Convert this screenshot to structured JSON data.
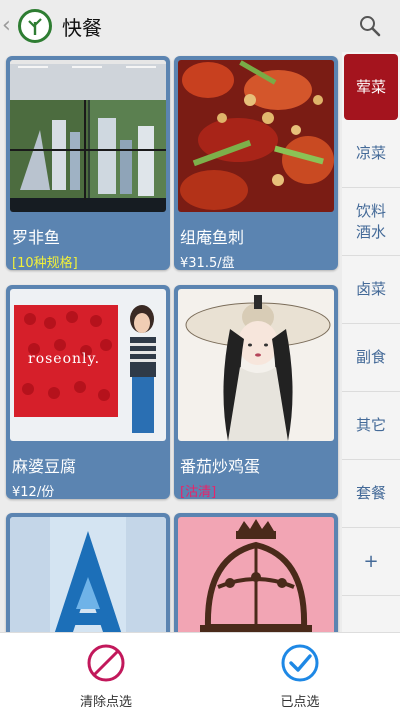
{
  "header": {
    "back_glyph": "‹",
    "title": "快餐",
    "logo_icon": "tree-logo-icon",
    "search_icon": "search-icon"
  },
  "menu_items": [
    {
      "name": "罗非鱼",
      "sub": "[10种规格]",
      "sub_type": "spec",
      "image": "city-model-screen"
    },
    {
      "name": "组庵鱼刺",
      "sub": "¥31.5/盘",
      "sub_type": "price",
      "image": "spicy-dish"
    },
    {
      "name": "麻婆豆腐",
      "sub": "¥12/份",
      "sub_type": "price",
      "image": "roseonly-poster"
    },
    {
      "name": "番茄炒鸡蛋",
      "sub": "[沽清]",
      "sub_type": "soldout",
      "image": "illustrated-girl-hat"
    },
    {
      "name": "",
      "sub": "",
      "sub_type": "",
      "image": "avatar-poster"
    },
    {
      "name": "",
      "sub": "",
      "sub_type": "",
      "image": "carriage-silhouette"
    }
  ],
  "poster_text": "roseonly.",
  "sidebar": {
    "items": [
      {
        "label": "荤菜",
        "active": true
      },
      {
        "label": "凉菜",
        "active": false
      },
      {
        "label": "饮料\n酒水",
        "active": false
      },
      {
        "label": "卤菜",
        "active": false
      },
      {
        "label": "副食",
        "active": false
      },
      {
        "label": "其它",
        "active": false
      },
      {
        "label": "套餐",
        "active": false
      },
      {
        "label": "+",
        "active": false
      }
    ]
  },
  "footer": {
    "clear_label": "清除点选",
    "selected_label": "已点选"
  },
  "colors": {
    "card_bg": "#5b84b1",
    "active_tab": "#a4141e",
    "spec_text": "#f1f03a",
    "soldout_text": "#e8236a",
    "clear_icon": "#c2185b",
    "selected_icon": "#1e88e5"
  }
}
